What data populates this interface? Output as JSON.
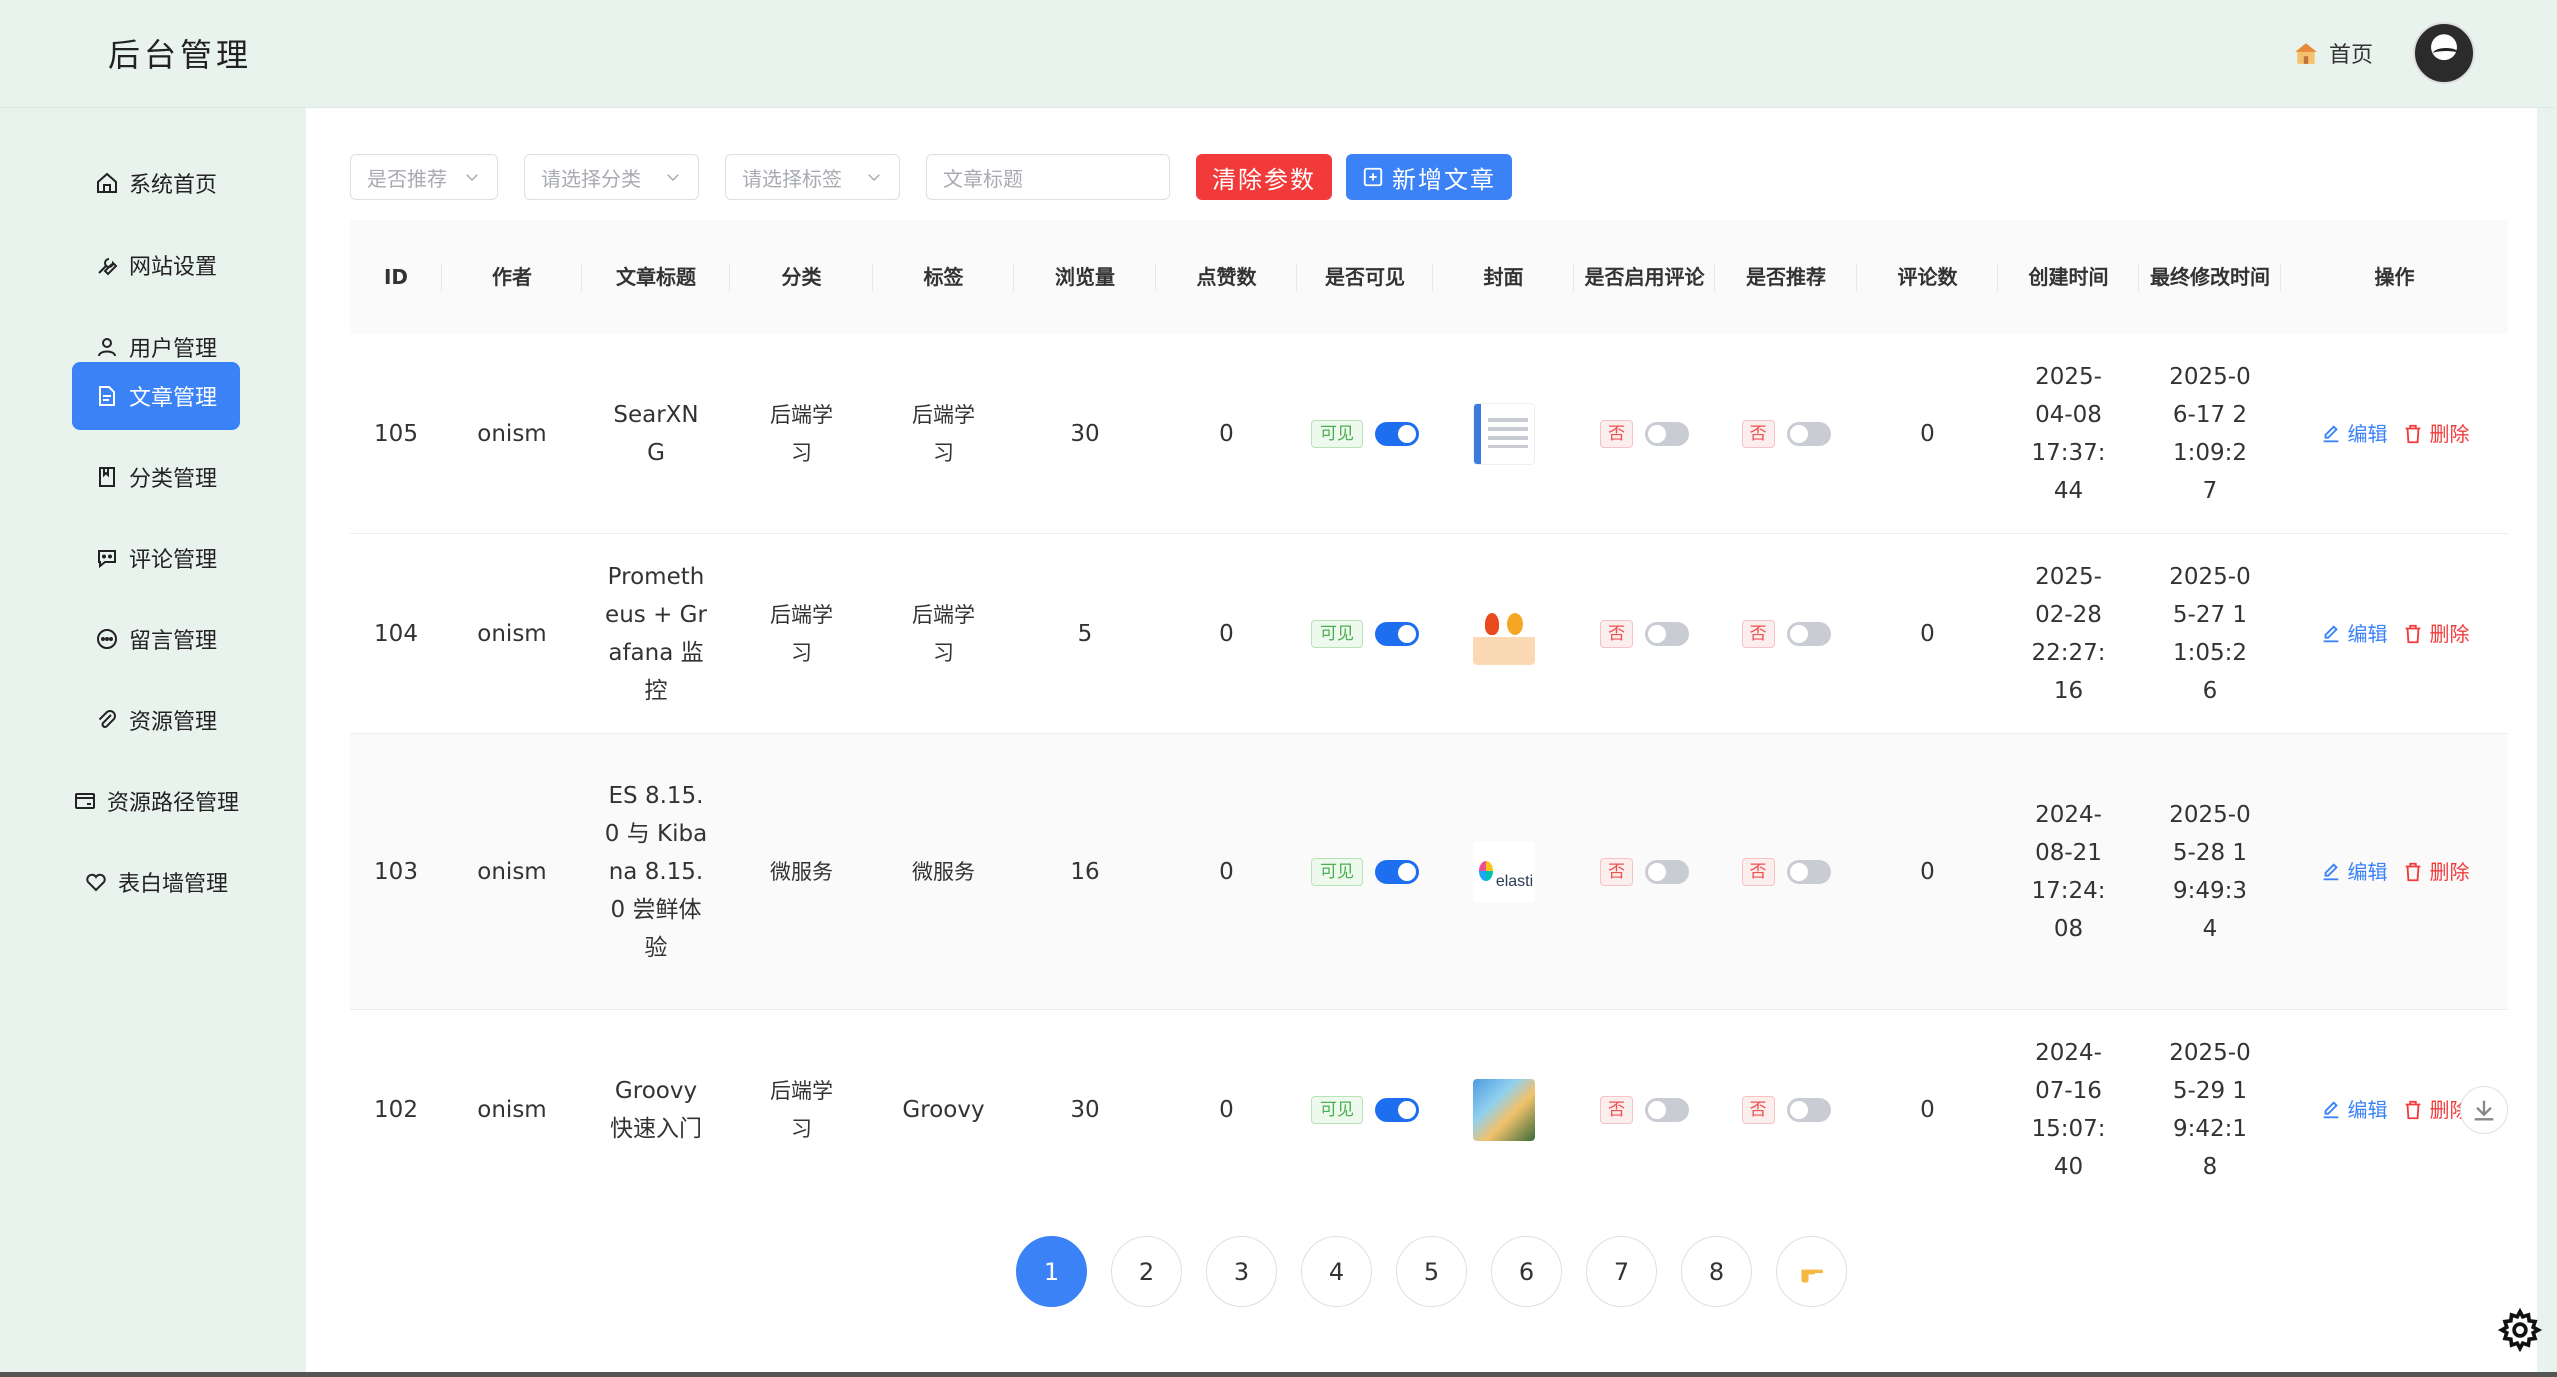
{
  "app": {
    "title": "后台管理"
  },
  "header": {
    "home_label": "首页"
  },
  "sidebar": {
    "items": [
      {
        "label": "系统首页",
        "icon": "home-icon"
      },
      {
        "label": "网站设置",
        "icon": "wrench-icon"
      },
      {
        "label": "用户管理",
        "icon": "user-icon"
      },
      {
        "label": "文章管理",
        "icon": "document-icon",
        "active": true
      },
      {
        "label": "分类管理",
        "icon": "book-icon"
      },
      {
        "label": "评论管理",
        "icon": "chat-icon"
      },
      {
        "label": "留言管理",
        "icon": "message-icon"
      },
      {
        "label": "资源管理",
        "icon": "paperclip-icon"
      },
      {
        "label": "资源路径管理",
        "icon": "card-icon"
      },
      {
        "label": "表白墙管理",
        "icon": "heart-icon"
      }
    ]
  },
  "filters": {
    "recommend_placeholder": "是否推荐",
    "category_placeholder": "请选择分类",
    "tag_placeholder": "请选择标签",
    "title_placeholder": "文章标题",
    "clear_label": "清除参数",
    "add_label": "新增文章"
  },
  "table": {
    "columns": [
      "ID",
      "作者",
      "文章标题",
      "分类",
      "标签",
      "浏览量",
      "点赞数",
      "是否可见",
      "封面",
      "是否启用评论",
      "是否推荐",
      "评论数",
      "创建时间",
      "最终修改时间",
      "操作"
    ],
    "visible_label": "可见",
    "no_label": "否",
    "edit_label": "编辑",
    "delete_label": "删除",
    "rows": [
      {
        "id": "105",
        "author": "onism",
        "title": "SearXNG",
        "category": "后端学习",
        "tag": "后端学习",
        "views": "30",
        "likes": "0",
        "visible": true,
        "cover": "cover-searxng",
        "comments_enabled": false,
        "recommended": false,
        "comment_count": "0",
        "created": "2025-04-08 17:37:44",
        "modified": "2025-06-17 21:09:27"
      },
      {
        "id": "104",
        "author": "onism",
        "title": "Prometheus + Grafana 监控",
        "category": "后端学习",
        "tag": "后端学习",
        "views": "5",
        "likes": "0",
        "visible": true,
        "cover": "cover-prometheus-grafana",
        "comments_enabled": false,
        "recommended": false,
        "comment_count": "0",
        "created": "2025-02-28 22:27:16",
        "modified": "2025-05-27 11:05:26"
      },
      {
        "id": "103",
        "author": "onism",
        "title": "ES 8.15.0 与 Kibana 8.15.0 尝鲜体验",
        "category": "微服务",
        "tag": "微服务",
        "views": "16",
        "likes": "0",
        "visible": true,
        "cover": "cover-elastic",
        "cover_text": "elastic",
        "comments_enabled": false,
        "recommended": false,
        "comment_count": "0",
        "created": "2024-08-21 17:24:08",
        "modified": "2025-05-28 19:49:34"
      },
      {
        "id": "102",
        "author": "onism",
        "title": "Groovy 快速入门",
        "category": "后端学习",
        "tag": "Groovy",
        "views": "30",
        "likes": "0",
        "visible": true,
        "cover": "cover-landscape",
        "comments_enabled": false,
        "recommended": false,
        "comment_count": "0",
        "created": "2024-07-16 15:07:40",
        "modified": "2025-05-29 19:42:18"
      }
    ]
  },
  "pagination": {
    "pages": [
      "1",
      "2",
      "3",
      "4",
      "5",
      "6",
      "7",
      "8"
    ],
    "current": "1",
    "next_icon": "pointing-hand-icon"
  },
  "colors": {
    "primary": "#3b82f6",
    "danger": "#f23a3a",
    "success": "#4caf50",
    "sidebar_bg": "#e9f3ee"
  }
}
